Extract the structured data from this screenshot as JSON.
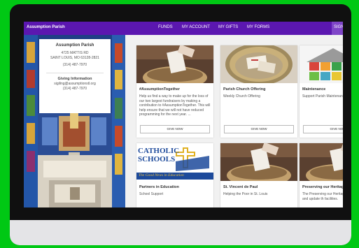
{
  "nav": {
    "brand": "Assumption Parish",
    "items": [
      "FUNDS",
      "MY ACCOUNT",
      "MY GIFTS",
      "MY FORMS"
    ],
    "signin": "SIGN"
  },
  "info": {
    "name": "Assumption Parish",
    "address1": "4725 MATTIS RD",
    "address2": "SAINT LOUIS, MO 63128-2821",
    "phone": "(314) 487-7970",
    "giving_heading": "Giving Information",
    "giving_email": "sigiling@assumptionstl.org",
    "giving_phone": "(314) 487-7970"
  },
  "funds": [
    {
      "title": "#AssumptionTogether",
      "description": "Help us find a way to make up for the loss of our two largest fundraisers by making a contribution to #AssumptionTogether. This will help ensure that we will not have reduced programming for the next year. ...",
      "button": "GIVE NOW"
    },
    {
      "title": "Parish Church Offering",
      "description": "Weekly Church Offering",
      "button": "GIVE NOW"
    },
    {
      "title": "Maintenance",
      "description": "Support Parish Maintenance P",
      "button": "GIVE NOW"
    },
    {
      "title": "Partners in Education",
      "description": "School Support",
      "logo_line1": "CATHOLIC",
      "logo_line2": "SCHOOLS",
      "logo_tagline": "The Good News in Education"
    },
    {
      "title": "St. Vincent de Paul",
      "description": "Helping the Poor in St. Louis"
    },
    {
      "title": "Preserving our Heritage",
      "description": "The Preserving our Heritage F helps maintain and update th facilities."
    }
  ],
  "colors": {
    "nav": "#5b17b0",
    "background": "#00c814"
  }
}
